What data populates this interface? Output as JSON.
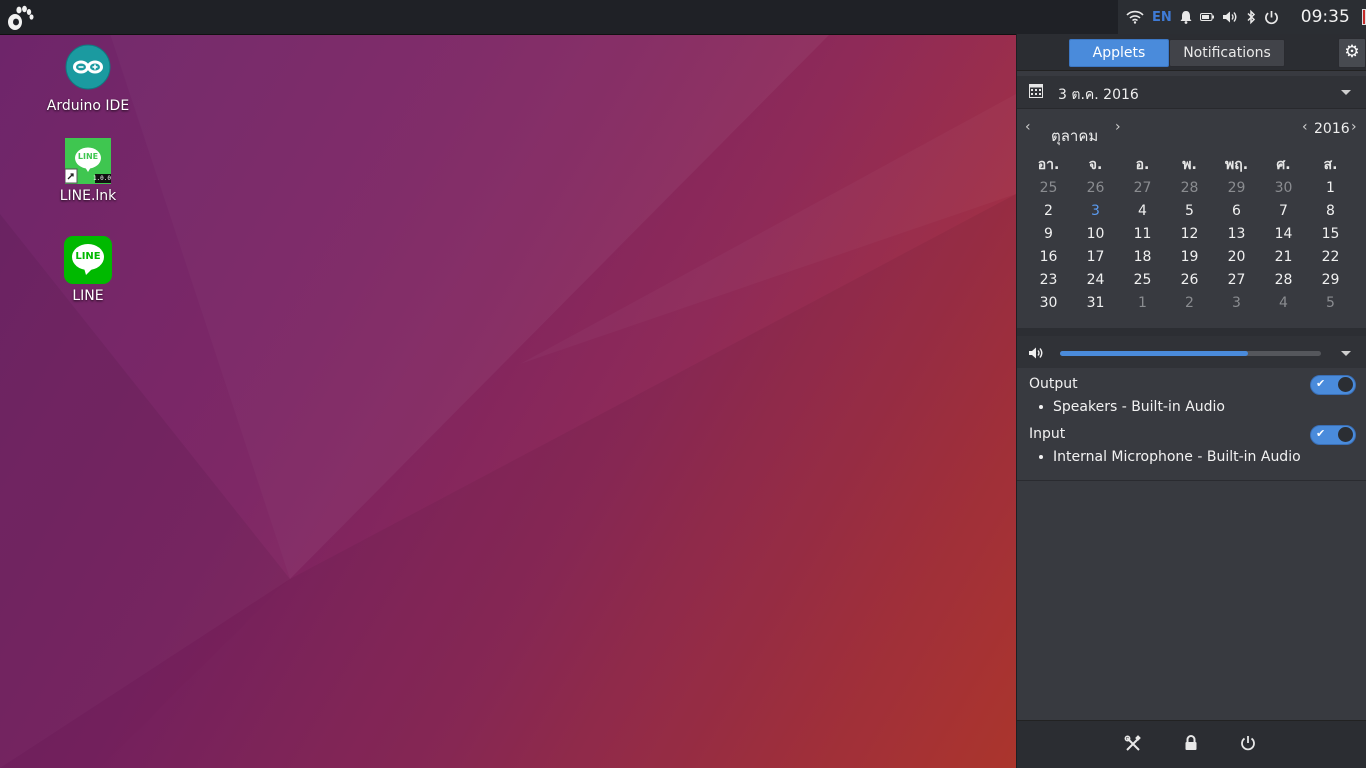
{
  "tray": {
    "language": "EN",
    "clock": "09:35"
  },
  "desktop": {
    "icons": [
      {
        "label": "Arduino IDE"
      },
      {
        "label": "LINE.lnk",
        "badge_text": "LINE",
        "version": "1.0.0"
      },
      {
        "label": "LINE",
        "badge_text": "LINE"
      }
    ]
  },
  "panel": {
    "tabs": {
      "applets": "Applets",
      "notifications": "Notifications"
    },
    "date_header": "3 ต.ค. 2016",
    "calendar": {
      "month": "ตุลาคม",
      "year": "2016",
      "weekdays": [
        "อา.",
        "จ.",
        "อ.",
        "พ.",
        "พฤ.",
        "ศ.",
        "ส."
      ],
      "weeks": [
        [
          "25",
          "26",
          "27",
          "28",
          "29",
          "30",
          "1"
        ],
        [
          "2",
          "3",
          "4",
          "5",
          "6",
          "7",
          "8"
        ],
        [
          "9",
          "10",
          "11",
          "12",
          "13",
          "14",
          "15"
        ],
        [
          "16",
          "17",
          "18",
          "19",
          "20",
          "21",
          "22"
        ],
        [
          "23",
          "24",
          "25",
          "26",
          "27",
          "28",
          "29"
        ],
        [
          "30",
          "31",
          "1",
          "2",
          "3",
          "4",
          "5"
        ]
      ],
      "today": "3"
    },
    "volume_fraction": 0.72,
    "sound": {
      "output_label": "Output",
      "output_device": "Speakers - Built-in Audio",
      "input_label": "Input",
      "input_device": "Internal Microphone - Built-in Audio"
    }
  },
  "colors": {
    "accent": "#4a8bdb",
    "panel_bg": "#383a40",
    "topbar_bg": "#1f2126"
  }
}
